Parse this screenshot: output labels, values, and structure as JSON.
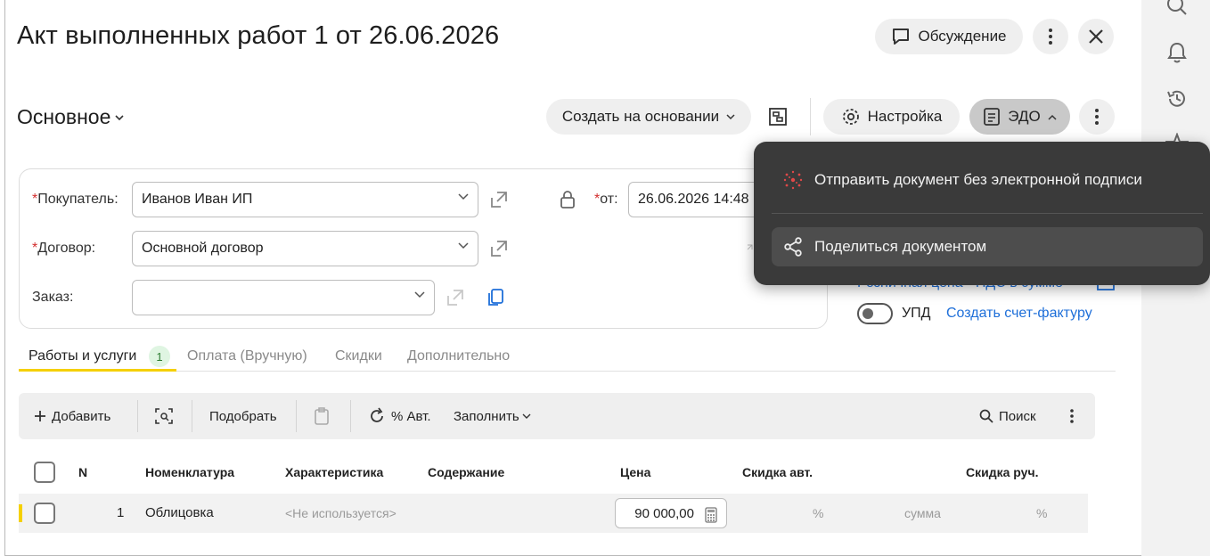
{
  "title": "Акт выполненных работ 1 от 26.06.2026",
  "header": {
    "discussion_label": "Обсуждение"
  },
  "section": {
    "label": "Основное"
  },
  "actions": {
    "create_based_label": "Создать на основании",
    "settings_label": "Настройка",
    "edo_label": "ЭДО"
  },
  "form": {
    "buyer_label": "Покупатель:",
    "buyer_value": "Иванов Иван ИП",
    "contract_label": "Договор:",
    "contract_value": "Основной договор",
    "order_label": "Заказ:",
    "order_value": "",
    "date_label": "от:",
    "date_value": "26.06.2026 14:48",
    "required_mark": "*"
  },
  "right_panel": {
    "price_mode_link": "Розничная цена · НДС в сумме",
    "upd_label": "УПД",
    "create_invoice_link": "Создать счет-фактуру"
  },
  "tabs": [
    {
      "label": "Работы и услуги",
      "badge": "1",
      "active": true
    },
    {
      "label": "Оплата (Вручную)"
    },
    {
      "label": "Скидки"
    },
    {
      "label": "Дополнительно"
    }
  ],
  "toolbar": {
    "add_label": "Добавить",
    "pick_label": "Подобрать",
    "auto_percent_label": "% Авт.",
    "fill_label": "Заполнить",
    "search_label": "Поиск"
  },
  "table": {
    "columns": [
      "N",
      "Номенклатура",
      "Характеристика",
      "Содержание",
      "Цена",
      "Скидка авт.",
      "Скидка руч."
    ],
    "rows": [
      {
        "n": "1",
        "nomenclature": "Облицовка",
        "characteristic": "<Не используется>",
        "content": "",
        "price": "90 000,00",
        "auto_discount_percent": "%",
        "auto_discount_sum": "сумма",
        "manual_discount_percent": "%"
      }
    ]
  },
  "edo_menu": {
    "items": [
      {
        "label": "Отправить документ без электронной подписи"
      },
      {
        "label": "Поделиться документом"
      }
    ]
  },
  "colors": {
    "accent_yellow": "#f5d000",
    "link_blue": "#1e6fd9",
    "required_red": "#d32f2f",
    "menu_bg": "#3a3a3a"
  }
}
